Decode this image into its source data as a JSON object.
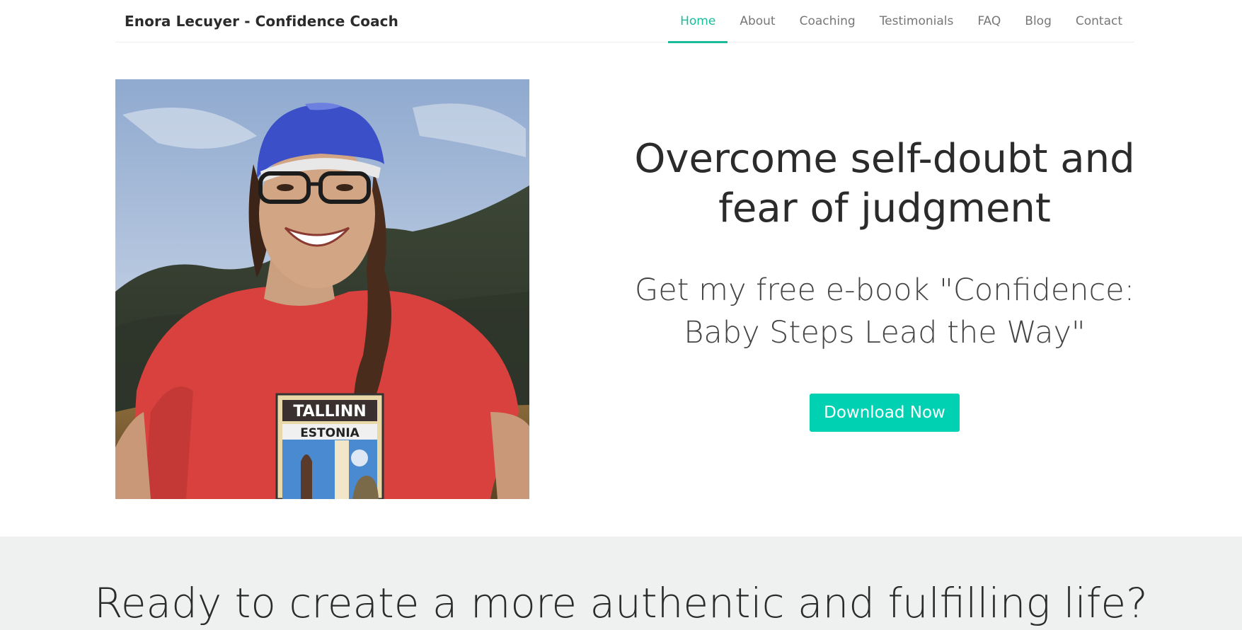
{
  "navbar": {
    "brand": "Enora Lecuyer - Confidence Coach",
    "items": [
      {
        "label": "Home",
        "active": true
      },
      {
        "label": "About",
        "active": false
      },
      {
        "label": "Coaching",
        "active": false
      },
      {
        "label": "Testimonials",
        "active": false
      },
      {
        "label": "FAQ",
        "active": false
      },
      {
        "label": "Blog",
        "active": false
      },
      {
        "label": "Contact",
        "active": false
      }
    ]
  },
  "hero": {
    "photo_alt": "Smiling woman in blue cap and red Tallinn Estonia t-shirt outdoors",
    "shirt_text_1": "TALLINN",
    "shirt_text_2": "ESTONIA",
    "headline": "Overcome self-doubt and fear of judgment",
    "subheadline": "Get my free e-book \"Confidence: Baby Steps Lead the Way\"",
    "cta_label": "Download Now"
  },
  "band": {
    "title": "Ready to create a more authentic and fulfilling life?"
  },
  "colors": {
    "accent": "#1abc9c",
    "button": "#00d1b2",
    "band_bg": "#eff1f0"
  }
}
